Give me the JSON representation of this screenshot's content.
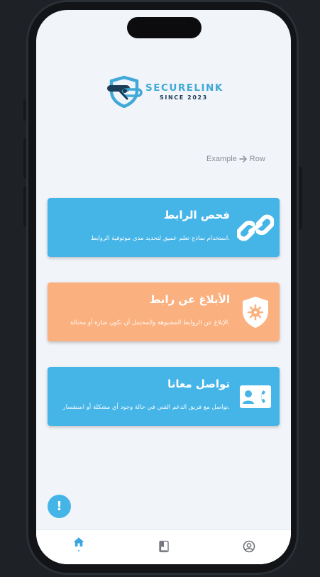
{
  "colors": {
    "accent_blue": "#45b5e8",
    "accent_orange": "#fbb07f",
    "logo_dark": "#1c3d57",
    "nav_active": "#3aa6df",
    "nav_inactive": "#6b6f76"
  },
  "logo": {
    "title": "SECURELINK",
    "subtitle": "SINCE 2023",
    "icon": "shield-link-logo"
  },
  "example": {
    "left": "Example",
    "right": "Row",
    "icon": "arrow-right-icon"
  },
  "cards": [
    {
      "title": "فحص الرابط",
      "description": ".استخدام نماذج تعلم عميق لتحديد مدى موثوقية الروابط",
      "icon": "link-icon",
      "color": "#45b5e8"
    },
    {
      "title": "الأبلاغ عن رابط",
      "description": ".الإبلاغ عن الروابط المشبوهة والمحتمل أن تكون ضارة أو محتالة",
      "icon": "virus-shield-icon",
      "color": "#fbb07f"
    },
    {
      "title": "تواصل معانا",
      "description": ".تواصل مع فريق الدعم الفني في حالة وجود أي مشكلة أو استفسار",
      "icon": "contact-phone-icon",
      "color": "#45b5e8"
    }
  ],
  "fab": {
    "label": "!",
    "icon": "alert-icon"
  },
  "bottom_nav": {
    "items": [
      {
        "name": "home",
        "icon": "home-icon",
        "active": true
      },
      {
        "name": "book",
        "icon": "book-icon",
        "active": false
      },
      {
        "name": "profile",
        "icon": "account-circle-icon",
        "active": false
      }
    ]
  }
}
